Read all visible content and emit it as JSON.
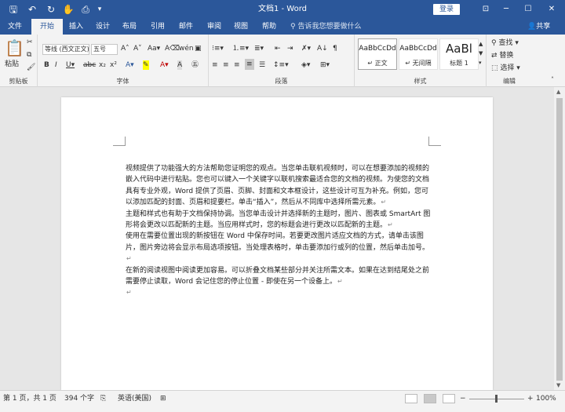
{
  "titlebar": {
    "title": "文档1 - Word",
    "login": "登录"
  },
  "tabs": [
    "文件",
    "开始",
    "插入",
    "设计",
    "布局",
    "引用",
    "邮件",
    "审阅",
    "视图",
    "帮助"
  ],
  "active_tab": "开始",
  "tellme": "告诉我您想要做什么",
  "share": "共享",
  "ribbon": {
    "clipboard": {
      "paste": "粘贴",
      "label": "剪贴板"
    },
    "font": {
      "name": "等线 (西文正文)",
      "size": "五号",
      "label": "字体"
    },
    "paragraph": {
      "label": "段落"
    },
    "styles": {
      "label": "样式",
      "items": [
        {
          "preview": "AaBbCcDd",
          "name": "↵ 正文"
        },
        {
          "preview": "AaBbCcDd",
          "name": "↵ 无间隔"
        },
        {
          "preview": "AaBl",
          "name": "标题 1"
        }
      ]
    },
    "editing": {
      "find": "查找",
      "replace": "替换",
      "select": "选择",
      "label": "编辑"
    }
  },
  "document": {
    "paragraphs": [
      "视频提供了功能强大的方法帮助您证明您的观点。当您单击联机视频时，可以在想要添加的视频的嵌入代码中进行粘贴。您也可以键入一个关键字以联机搜索最适合您的文档的视频。为使您的文档具有专业外观，Word 提供了页眉、页脚、封面和文本框设计，这些设计可互为补充。例如，您可以添加匹配的封面、页眉和提要栏。单击“插入”，然后从不同库中选择所需元素。",
      "主题和样式也有助于文档保持协调。当您单击设计并选择新的主题时，图片、图表或 SmartArt 图形将会更改以匹配新的主题。当应用样式时，您的标题会进行更改以匹配新的主题。",
      "使用在需要位置出现的新按钮在 Word 中保存时间。若要更改图片适应文档的方式，请单击该图片，图片旁边将会显示布局选项按钮。当处理表格时，单击要添加行或列的位置，然后单击加号。",
      "在新的阅读视图中阅读更加容易。可以折叠文档某些部分并关注所需文本。如果在达到结尾处之前需要停止读取，Word 会记住您的停止位置 - 即使在另一个设备上。",
      ""
    ]
  },
  "status": {
    "page": "第 1 页，共 1 页",
    "words": "394 个字",
    "language": "英语(美国)",
    "zoom": "100%"
  }
}
